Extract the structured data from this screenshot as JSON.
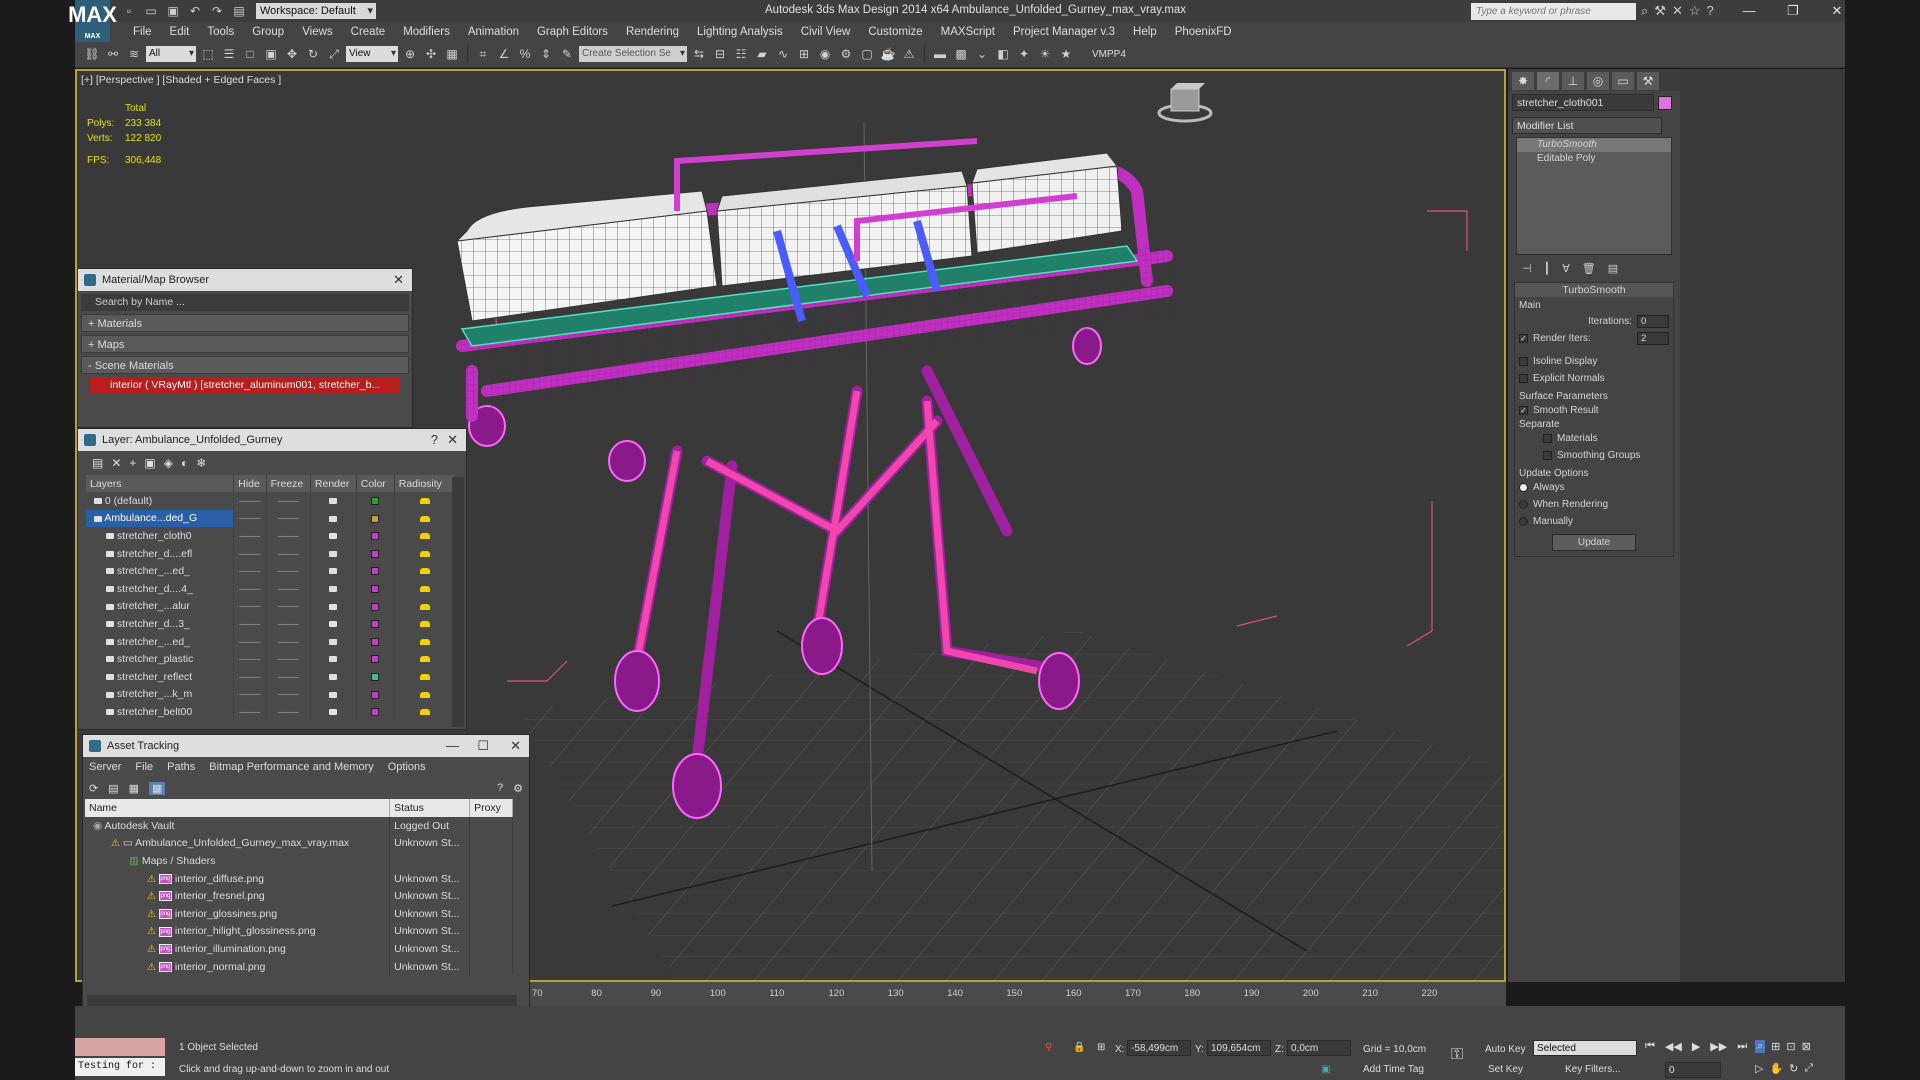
{
  "app": {
    "window_title": "Autodesk 3ds Max Design 2014 x64      Ambulance_Unfolded_Gurney_max_vray.max",
    "workspace": "Workspace: Default",
    "search_placeholder": "Type a keyword or phrase",
    "logo": "MAX"
  },
  "menu": [
    "File",
    "Edit",
    "Tools",
    "Group",
    "Views",
    "Create",
    "Modifiers",
    "Animation",
    "Graph Editors",
    "Rendering",
    "Lighting Analysis",
    "Civil View",
    "Customize",
    "MAXScript",
    "Project Manager v.3",
    "Help",
    "PhoenixFD"
  ],
  "toolbar": {
    "selection_filter": "All",
    "ref_coord": "View",
    "named_selection": "Create Selection Se",
    "plugin_label": "VMPP4"
  },
  "viewport": {
    "label": "[+] [Perspective ] [Shaded + Edged Faces ]",
    "stats": {
      "header": "Total",
      "polys_label": "Polys:",
      "polys": "233 384",
      "verts_label": "Verts:",
      "verts": "122 820",
      "fps_label": "FPS:",
      "fps": "306,448"
    }
  },
  "material_browser": {
    "title": "Material/Map Browser",
    "search_placeholder": "Search by Name ...",
    "sections": [
      "+ Materials",
      "+ Maps",
      "- Scene Materials"
    ],
    "scene_item": "interior  ( VRayMtl )  [stretcher_aluminum001, stretcher_b..."
  },
  "layer_explorer": {
    "title": "Layer: Ambulance_Unfolded_Gurney",
    "columns": [
      "Layers",
      "Hide",
      "Freeze",
      "Render",
      "Color",
      "Radiosity"
    ],
    "rows": [
      {
        "name": "0 (default)",
        "color": "#2f9d2f",
        "selected": false,
        "indent": 1
      },
      {
        "name": "Ambulance...ded_G",
        "color": "#c8a030",
        "selected": true,
        "indent": 1
      },
      {
        "name": "stretcher_cloth0",
        "color": "#c040c0",
        "selected": false,
        "indent": 2
      },
      {
        "name": "stretcher_d....efl",
        "color": "#c040c0",
        "selected": false,
        "indent": 2
      },
      {
        "name": "stretcher_...ed_",
        "color": "#c040c0",
        "selected": false,
        "indent": 2
      },
      {
        "name": "stretcher_d....4_",
        "color": "#c040c0",
        "selected": false,
        "indent": 2
      },
      {
        "name": "stretcher_...alur",
        "color": "#c040c0",
        "selected": false,
        "indent": 2
      },
      {
        "name": "stretcher_d...3_",
        "color": "#c040c0",
        "selected": false,
        "indent": 2
      },
      {
        "name": "stretcher_...ed_",
        "color": "#c040c0",
        "selected": false,
        "indent": 2
      },
      {
        "name": "stretcher_plastic",
        "color": "#c040c0",
        "selected": false,
        "indent": 2
      },
      {
        "name": "stretcher_reflect",
        "color": "#40c080",
        "selected": false,
        "indent": 2
      },
      {
        "name": "stretcher_...k_m",
        "color": "#c040c0",
        "selected": false,
        "indent": 2
      },
      {
        "name": "stretcher_belt00",
        "color": "#c040c0",
        "selected": false,
        "indent": 2
      }
    ]
  },
  "asset_tracking": {
    "title": "Asset Tracking",
    "menu": [
      "Server",
      "File",
      "Paths",
      "Bitmap Performance and Memory",
      "Options"
    ],
    "columns": [
      "Name",
      "Status",
      "Proxy"
    ],
    "rows": [
      {
        "name": "Autodesk Vault",
        "status": "Logged Out",
        "indent": 0,
        "icon": "vault"
      },
      {
        "name": "Ambulance_Unfolded_Gurney_max_vray.max",
        "status": "Unknown St...",
        "indent": 1,
        "icon": "file"
      },
      {
        "name": "Maps / Shaders",
        "status": "",
        "indent": 2,
        "icon": "folder"
      },
      {
        "name": "interior_diffuse.png",
        "status": "Unknown St...",
        "indent": 3,
        "icon": "png"
      },
      {
        "name": "interior_fresnel.png",
        "status": "Unknown St...",
        "indent": 3,
        "icon": "png"
      },
      {
        "name": "interior_glossines.png",
        "status": "Unknown St...",
        "indent": 3,
        "icon": "png"
      },
      {
        "name": "interior_hilight_glossiness.png",
        "status": "Unknown St...",
        "indent": 3,
        "icon": "png"
      },
      {
        "name": "interior_illumination.png",
        "status": "Unknown St...",
        "indent": 3,
        "icon": "png"
      },
      {
        "name": "interior_normal.png",
        "status": "Unknown St...",
        "indent": 3,
        "icon": "png"
      }
    ]
  },
  "command_panel": {
    "object_name": "stretcher_cloth001",
    "modifier_list": "Modifier List",
    "stack": [
      "TurboSmooth",
      "Editable Poly"
    ],
    "turbosmooth": {
      "title": "TurboSmooth",
      "main_label": "Main",
      "iterations_label": "Iterations:",
      "iterations": "0",
      "render_iters_label": "Render Iters:",
      "render_iters": "2",
      "isoline": "Isoline Display",
      "explicit_normals": "Explicit Normals",
      "surface_params": "Surface Parameters",
      "smooth_result": "Smooth Result",
      "separate": "Separate",
      "materials": "Materials",
      "smoothing_groups": "Smoothing Groups",
      "update_options": "Update Options",
      "always": "Always",
      "when_rendering": "When Rendering",
      "manually": "Manually",
      "update_button": "Update"
    }
  },
  "timeline": {
    "ticks": [
      "70",
      "80",
      "90",
      "100",
      "110",
      "120",
      "130",
      "140",
      "150",
      "160",
      "170",
      "180",
      "190",
      "200",
      "210",
      "220"
    ]
  },
  "statusbar": {
    "maxscript": "Testing for :",
    "selected": "1 Object Selected",
    "prompt": "Click and drag up-and-down to zoom in and out",
    "x_label": "X:",
    "x": "-58,499cm",
    "y_label": "Y:",
    "y": "109,654cm",
    "z_label": "Z:",
    "z": "0,0cm",
    "grid": "Grid = 10,0cm",
    "add_time_tag": "Add Time Tag",
    "auto_key": "Auto Key",
    "set_key": "Set Key",
    "key_mode": "Selected",
    "key_filters": "Key Filters...",
    "frame": "0"
  }
}
